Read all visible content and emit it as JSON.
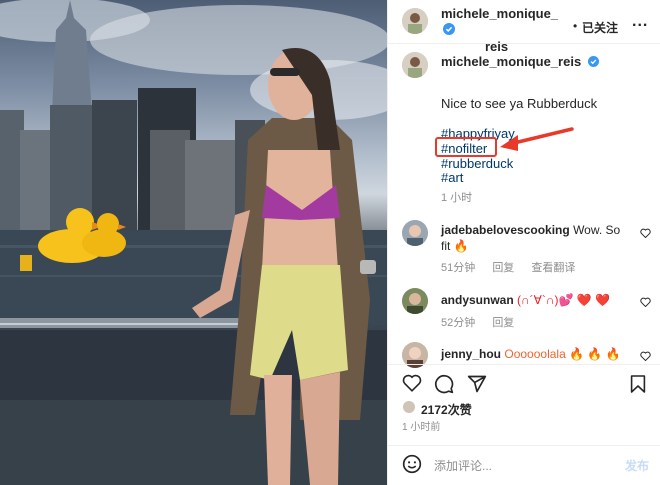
{
  "header": {
    "username_line1": "michele_monique_",
    "username_line2": "reis",
    "separator": "•",
    "follow_label": "已关注",
    "more_label": "..."
  },
  "caption": {
    "username": "michele_monique_reis",
    "text": "Nice to see ya Rubberduck",
    "hashtags": [
      "#happyfriyay",
      "#nofilter",
      "#rubberduck",
      "#art"
    ],
    "time": "1 小时"
  },
  "comments": [
    {
      "user": "jadebabelovescooking",
      "text_line1": "Wow. So",
      "text_line2": "fit 🔥",
      "time": "51分钟",
      "reply": "回复",
      "translate": "查看翻译"
    },
    {
      "user": "andysunwan",
      "text": "(∩´∀`∩)💕 ❤️ ❤️",
      "time": "52分钟",
      "reply": "回复"
    },
    {
      "user": "jenny_hou",
      "text": "Oooooolala 🔥 🔥 🔥"
    }
  ],
  "likes": "2172次赞",
  "posted": "1 小时前",
  "comment_input": {
    "placeholder": "添加评论...",
    "post_label": "发布"
  },
  "colors": {
    "verified": "#3897f0",
    "hashtag": "#00376b",
    "highlight": "#e8392b",
    "muted": "#8e8e8e"
  },
  "icons": [
    "verified-badge-icon",
    "more-icon",
    "heart-icon",
    "comment-icon",
    "share-icon",
    "bookmark-icon",
    "emoji-icon",
    "annotation-arrow"
  ]
}
